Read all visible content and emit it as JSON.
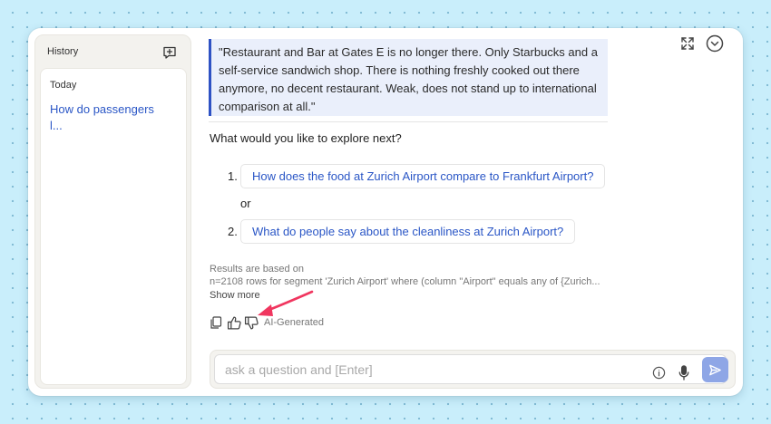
{
  "sidebar": {
    "title": "History",
    "group_label": "Today",
    "items": [
      {
        "label": "How do passengers l..."
      }
    ]
  },
  "main": {
    "quote": "\"Restaurant and Bar at Gates E is no longer there. Only Starbucks and a self-service sandwich shop. There is nothing freshly cooked out there anymore, no decent restaurant. Weak, does not stand up to international comparison at all.\"",
    "prompt": "What would you like to explore next?",
    "suggestions": [
      {
        "number": "1.",
        "label": "How does the food at Zurich Airport compare to Frankfurt Airport?"
      },
      {
        "number": "2.",
        "label": "What do people say about the cleanliness at Zurich Airport?"
      }
    ],
    "separator": "or",
    "results_label": "Results are based on",
    "results_detail": "n=2108 rows for segment 'Zurich Airport' where (column \"Airport\" equals any of {Zurich...",
    "show_more": "Show more",
    "ai_label": "AI-Generated"
  },
  "composer": {
    "placeholder": "ask a question and [Enter]",
    "value": ""
  },
  "colors": {
    "accent": "#2a56c6",
    "quote_border": "#2e52c4",
    "quote_bg": "#eaeffb",
    "send_button": "#8ea6e6",
    "annotation_arrow": "#f0365f"
  },
  "icons": [
    "new-chat-icon",
    "expand-icon",
    "chevron-down-circle-icon",
    "copy-icon",
    "thumbs-up-icon",
    "thumbs-down-icon",
    "info-icon",
    "microphone-icon",
    "send-icon"
  ]
}
